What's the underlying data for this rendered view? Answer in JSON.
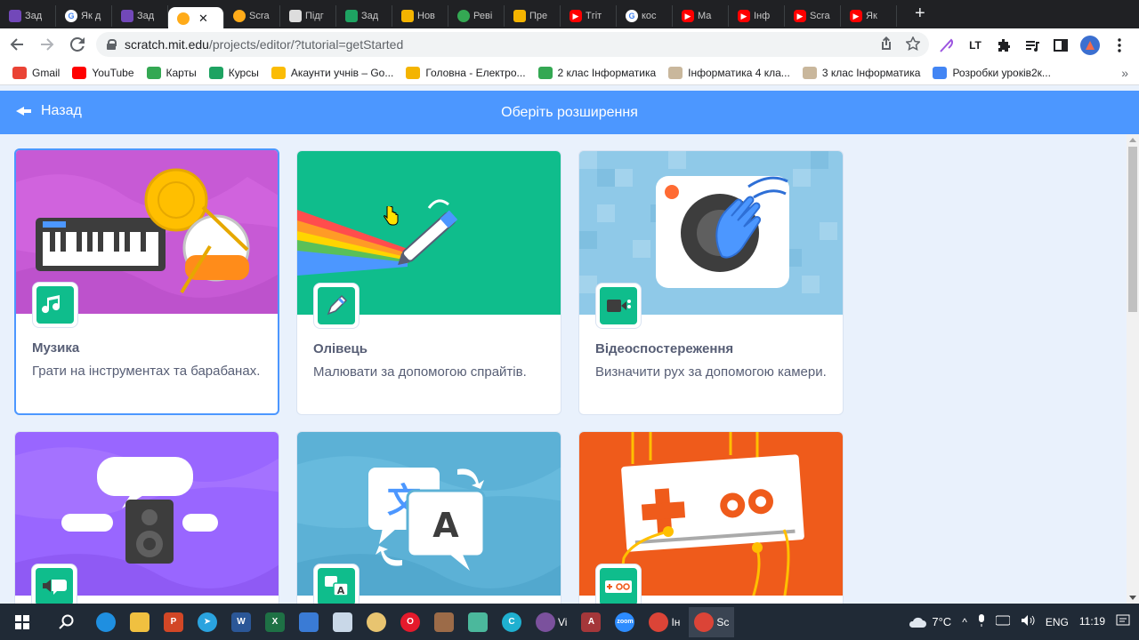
{
  "browser": {
    "tabs": [
      {
        "label": "Зад",
        "icon": "form"
      },
      {
        "label": "Як д",
        "icon": "google"
      },
      {
        "label": "Зад",
        "icon": "form"
      },
      {
        "label": "",
        "icon": "scratch",
        "active": true
      },
      {
        "label": "Scra",
        "icon": "scratch"
      },
      {
        "label": "Підг",
        "icon": "doc"
      },
      {
        "label": "Зад",
        "icon": "classroom"
      },
      {
        "label": "Нов",
        "icon": "slides"
      },
      {
        "label": "Реві",
        "icon": "drive"
      },
      {
        "label": "Пре",
        "icon": "slides"
      },
      {
        "label": "Тгіт",
        "icon": "youtube"
      },
      {
        "label": "кос",
        "icon": "google"
      },
      {
        "label": "Ма",
        "icon": "youtube"
      },
      {
        "label": "Інф",
        "icon": "youtube"
      },
      {
        "label": "Scra",
        "icon": "youtube"
      },
      {
        "label": "Як",
        "icon": "youtube"
      }
    ],
    "address": {
      "host": "scratch.mit.edu",
      "path": "/projects/editor/?tutorial=getStarted"
    }
  },
  "bookmarks": [
    {
      "label": "Gmail",
      "color": "#ea4335"
    },
    {
      "label": "YouTube",
      "color": "#ff0000"
    },
    {
      "label": "Карты",
      "color": "#34a853"
    },
    {
      "label": "Курсы",
      "color": "#1ea362"
    },
    {
      "label": "Акаунти учнів – Go...",
      "color": "#fbbc04"
    },
    {
      "label": "Головна - Електро...",
      "color": "#f4b400"
    },
    {
      "label": "2 клас Інформатика",
      "color": "#34a853"
    },
    {
      "label": "Інформатика 4 кла...",
      "color": "#c9b79c"
    },
    {
      "label": "3 клас Інформатика",
      "color": "#c9b79c"
    },
    {
      "label": "Розробки уроків2к...",
      "color": "#4285f4"
    }
  ],
  "header": {
    "back_label": "Назад",
    "title": "Оберіть розширення"
  },
  "extensions": [
    {
      "title": "Музика",
      "description": "Грати на інструментах та барабанах.",
      "bg": "#c75ad5",
      "icon_bg": "#0fbd8c",
      "icon": "music-icon"
    },
    {
      "title": "Олівець",
      "description": "Малювати за допомогою спрайтів.",
      "bg": "#0fbd8c",
      "icon_bg": "#0fbd8c",
      "icon": "pen-icon"
    },
    {
      "title": "Відеоспостереження",
      "description": "Визначити рух за допомогою камери.",
      "bg": "#8fc9e8",
      "icon_bg": "#0fbd8c",
      "icon": "video-icon"
    },
    {
      "title": "",
      "description": "",
      "bg": "#9966ff",
      "icon_bg": "#0fbd8c",
      "icon": "speech-icon"
    },
    {
      "title": "",
      "description": "",
      "bg": "#5cb1d6",
      "icon_bg": "#0fbd8c",
      "icon": "translate-icon"
    },
    {
      "title": "",
      "description": "",
      "bg": "#ef5b1b",
      "icon_bg": "#0fbd8c",
      "icon": "makey-icon"
    }
  ],
  "taskbar": {
    "apps": [
      "Vi",
      "Ін",
      "Sc"
    ],
    "temperature": "7°C",
    "language": "ENG",
    "time": "11:19"
  }
}
